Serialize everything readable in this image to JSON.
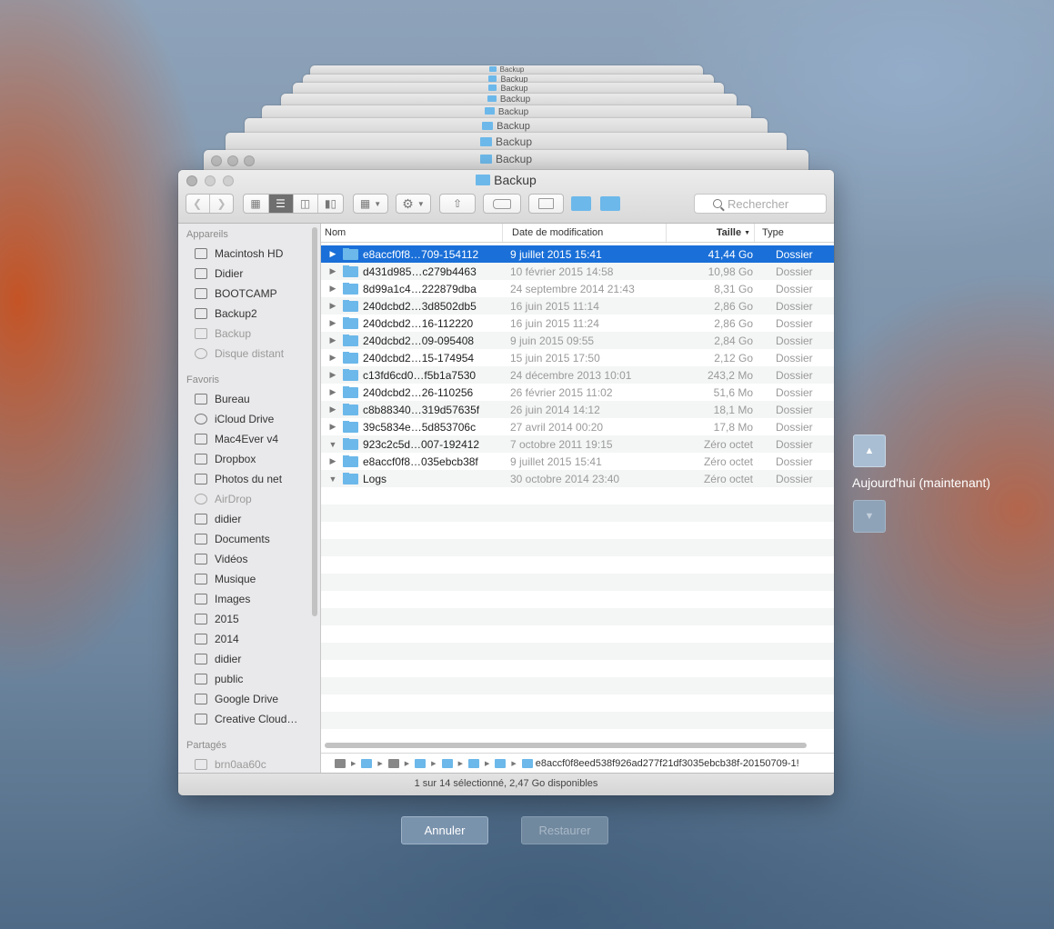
{
  "window": {
    "title": "Backup"
  },
  "ghost_title": "Backup",
  "search": {
    "placeholder": "Rechercher"
  },
  "sidebar": {
    "sections": [
      {
        "header": "Appareils",
        "items": [
          {
            "label": "Macintosh HD",
            "icon": "disk-icon"
          },
          {
            "label": "Didier",
            "icon": "laptop-icon"
          },
          {
            "label": "BOOTCAMP",
            "icon": "disk-icon"
          },
          {
            "label": "Backup2",
            "icon": "disk-icon"
          },
          {
            "label": "Backup",
            "icon": "disk-icon",
            "dim": true
          },
          {
            "label": "Disque distant",
            "icon": "remote-disk-icon",
            "dim": true
          }
        ]
      },
      {
        "header": "Favoris",
        "items": [
          {
            "label": "Bureau",
            "icon": "desktop-folder-icon"
          },
          {
            "label": "iCloud Drive",
            "icon": "cloud-icon"
          },
          {
            "label": "Mac4Ever v4",
            "icon": "folder-icon"
          },
          {
            "label": "Dropbox",
            "icon": "folder-icon"
          },
          {
            "label": "Photos du net",
            "icon": "folder-icon"
          },
          {
            "label": "AirDrop",
            "icon": "airdrop-icon",
            "dim": true
          },
          {
            "label": "didier",
            "icon": "home-icon"
          },
          {
            "label": "Documents",
            "icon": "documents-icon"
          },
          {
            "label": "Vidéos",
            "icon": "movies-icon"
          },
          {
            "label": "Musique",
            "icon": "music-icon"
          },
          {
            "label": "Images",
            "icon": "camera-icon"
          },
          {
            "label": "2015",
            "icon": "folder-icon"
          },
          {
            "label": "2014",
            "icon": "folder-icon"
          },
          {
            "label": "didier",
            "icon": "folder-icon"
          },
          {
            "label": "public",
            "icon": "folder-icon"
          },
          {
            "label": "Google Drive",
            "icon": "folder-icon"
          },
          {
            "label": "Creative Cloud…",
            "icon": "folder-icon"
          }
        ]
      },
      {
        "header": "Partagés",
        "items": [
          {
            "label": "brn0aa60c",
            "icon": "printer-monitor-icon",
            "dim": true
          }
        ]
      }
    ]
  },
  "columns": {
    "name": "Nom",
    "date": "Date de modification",
    "size": "Taille",
    "type": "Type"
  },
  "rows": [
    {
      "name": "e8accf0f8…709-154112",
      "date": "9 juillet 2015 15:41",
      "size": "41,44 Go",
      "type": "Dossier",
      "selected": true,
      "expanded": false
    },
    {
      "name": "d431d985…c279b4463",
      "date": "10 février 2015 14:58",
      "size": "10,98 Go",
      "type": "Dossier"
    },
    {
      "name": "8d99a1c4…222879dba",
      "date": "24 septembre 2014 21:43",
      "size": "8,31 Go",
      "type": "Dossier"
    },
    {
      "name": "240dcbd2…3d8502db5",
      "date": "16 juin 2015 11:14",
      "size": "2,86 Go",
      "type": "Dossier"
    },
    {
      "name": "240dcbd2…16-112220",
      "date": "16 juin 2015 11:24",
      "size": "2,86 Go",
      "type": "Dossier"
    },
    {
      "name": "240dcbd2…09-095408",
      "date": "9 juin 2015 09:55",
      "size": "2,84 Go",
      "type": "Dossier"
    },
    {
      "name": "240dcbd2…15-174954",
      "date": "15 juin 2015 17:50",
      "size": "2,12 Go",
      "type": "Dossier"
    },
    {
      "name": "c13fd6cd0…f5b1a7530",
      "date": "24 décembre 2013 10:01",
      "size": "243,2 Mo",
      "type": "Dossier"
    },
    {
      "name": "240dcbd2…26-110256",
      "date": "26 février 2015 11:02",
      "size": "51,6 Mo",
      "type": "Dossier"
    },
    {
      "name": "c8b88340…319d57635f",
      "date": "26 juin 2014 14:12",
      "size": "18,1 Mo",
      "type": "Dossier"
    },
    {
      "name": "39c5834e…5d853706c",
      "date": "27 avril 2014 00:20",
      "size": "17,8 Mo",
      "type": "Dossier"
    },
    {
      "name": "923c2c5d…007-192412",
      "date": "7 octobre 2011 19:15",
      "size": "Zéro octet",
      "type": "Dossier",
      "expanded": true
    },
    {
      "name": "e8accf0f8…035ebcb38f",
      "date": "9 juillet 2015 15:41",
      "size": "Zéro octet",
      "type": "Dossier"
    },
    {
      "name": "Logs",
      "date": "30 octobre 2014 23:40",
      "size": "Zéro octet",
      "type": "Dossier",
      "expanded": true
    }
  ],
  "path_bar": {
    "last": "e8accf0f8eed538f926ad277f21df3035ebcb38f-20150709-1!"
  },
  "status_bar": "1 sur 14 sélectionné, 2,47 Go disponibles",
  "buttons": {
    "cancel": "Annuler",
    "restore": "Restaurer"
  },
  "time_machine": {
    "label": "Aujourd'hui (maintenant)",
    "up_icon": "chevron-up-icon",
    "down_icon": "chevron-down-icon"
  },
  "colors": {
    "selection": "#1a6fd8",
    "folder": "#6cb8ea"
  }
}
